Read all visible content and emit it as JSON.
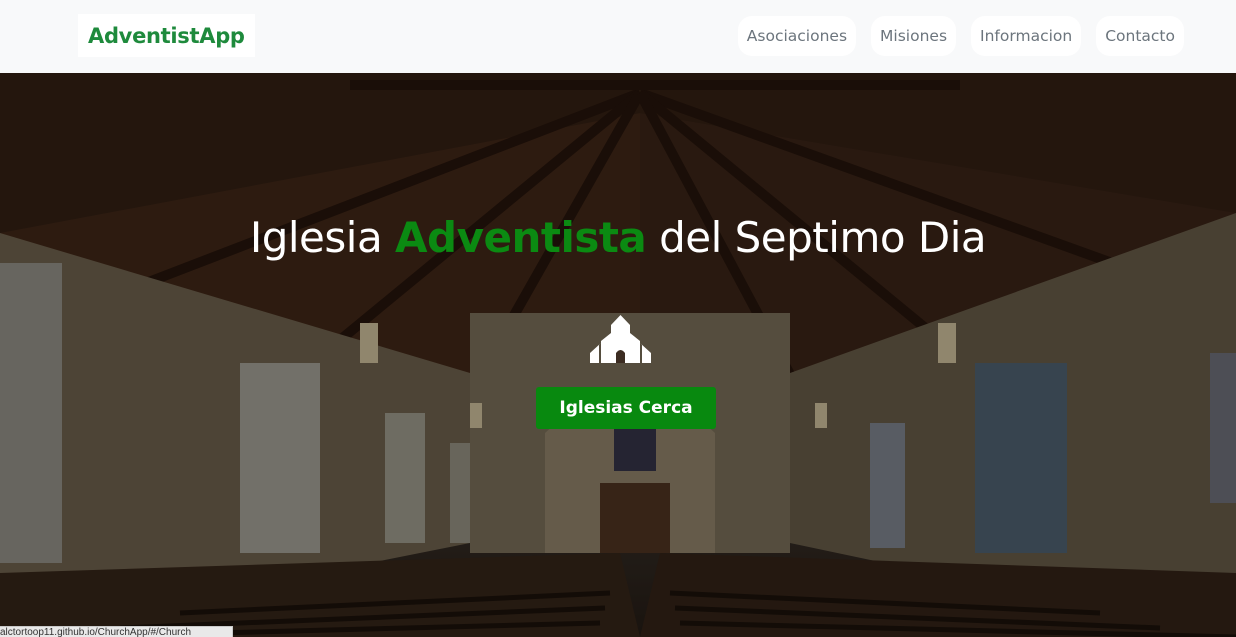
{
  "navbar": {
    "brand": "AdventistApp",
    "links": [
      {
        "label": "Asociaciones"
      },
      {
        "label": "Misiones"
      },
      {
        "label": "Informacion"
      },
      {
        "label": "Contacto"
      }
    ]
  },
  "hero": {
    "title_before": "Iglesia ",
    "title_accent": "Adventista",
    "title_after": " del Septimo Dia",
    "icon": "church-icon",
    "button_label": "Iglesias Cerca"
  },
  "status_bar": {
    "url": "alctortoop11.github.io/ChurchApp/#/Church"
  },
  "colors": {
    "brand": "#1e8a3c",
    "accent": "#0b8a12",
    "button": "#08890f",
    "navbar_bg": "#f8f9fa"
  }
}
